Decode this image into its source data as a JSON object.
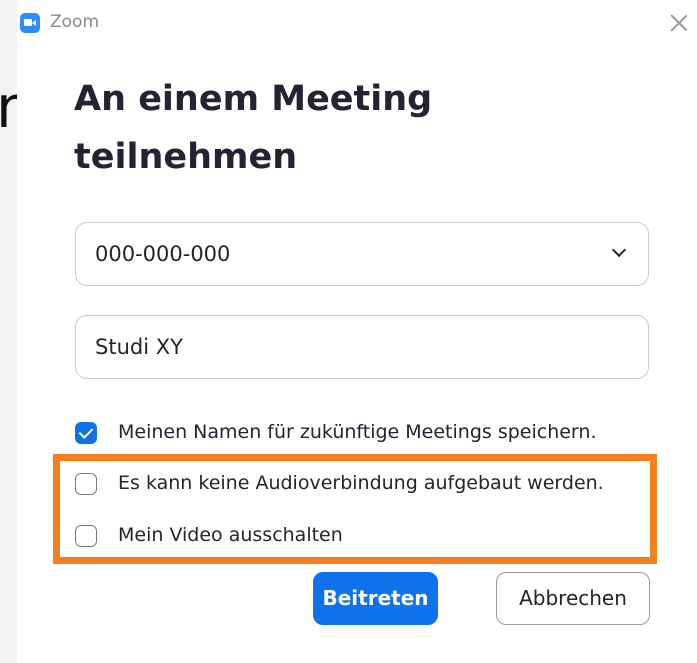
{
  "background": {
    "fragment_text": "n"
  },
  "window": {
    "app_name": "Zoom",
    "close_icon": "close-icon"
  },
  "dialog": {
    "heading_line1": "An einem Meeting",
    "heading_line2": "teilnehmen"
  },
  "meeting_id": {
    "value": "000-000-000",
    "dropdown_icon": "chevron-down-icon"
  },
  "name_field": {
    "value": "Studi XY"
  },
  "options": [
    {
      "label": "Meinen Namen für zukünftige Meetings speichern.",
      "checked": true
    },
    {
      "label": "Es kann keine Audioverbindung aufgebaut werden.",
      "checked": false
    },
    {
      "label": "Mein Video ausschalten",
      "checked": false
    }
  ],
  "buttons": {
    "join_label": "Beitreten",
    "cancel_label": "Abbrechen"
  },
  "colors": {
    "accent": "#0e72ed",
    "highlight": "#f47f20",
    "text": "#232333"
  }
}
